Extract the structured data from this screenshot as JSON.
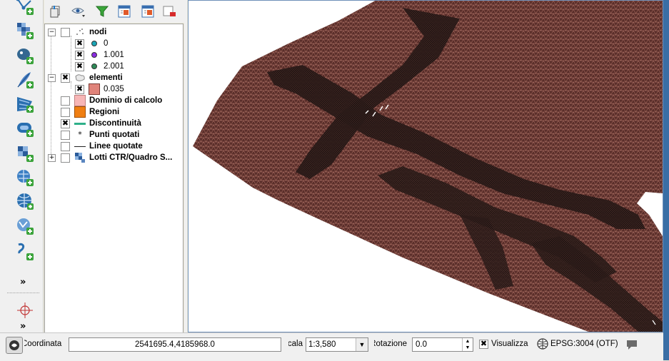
{
  "left_toolbar": {
    "tools": [
      {
        "name": "add-vector-layer-icon"
      },
      {
        "name": "add-raster-layer-icon"
      },
      {
        "name": "add-postgis-layer-icon"
      },
      {
        "name": "add-spatialite-layer-icon"
      },
      {
        "name": "add-mssql-layer-icon"
      },
      {
        "name": "add-oracle-layer-icon"
      },
      {
        "name": "add-wms-layer-icon"
      },
      {
        "name": "add-wcs-layer-icon"
      },
      {
        "name": "add-wfs-layer-icon"
      },
      {
        "name": "add-new-layer-icon"
      },
      {
        "name": "add-delimited-text-layer-icon"
      }
    ],
    "more_label": "»",
    "more2_label": "»"
  },
  "layers_toolbar": {
    "buttons": [
      "add-group-icon",
      "manage-visibility-icon",
      "filter-legend-icon",
      "expand-all-icon",
      "collapse-all-icon",
      "remove-layer-icon"
    ]
  },
  "layers": {
    "nodi": "nodi",
    "nodi_0": "0",
    "nodi_1": "1.001",
    "nodi_2": "2.001",
    "elementi": "elementi",
    "elementi_0": "0.035",
    "dominio": "Dominio di calcolo",
    "regioni": "Regioni",
    "discontinuita": "Discontinuità",
    "punti": "Punti quotati",
    "linee": "Linee quotate",
    "lotti": "Lotti CTR/Quadro S..."
  },
  "colors": {
    "mesh_fill": "#5a2e2a",
    "mesh_line": "#e8a08e",
    "mesh_dense": "#1e1412",
    "nodi_0": "#1aa6b7",
    "nodi_1": "#8a2be2",
    "nodi_2": "#2e8b57",
    "elementi_sym": "#e0837a",
    "dominio_sym": "#f7b6b6",
    "regioni_sym": "#f07f12",
    "discontinuita_sym": "#2fb08a"
  },
  "status": {
    "coord_label": "Coordinata",
    "coord_value": "2541695.4,4185968.0",
    "scale_label": "Scala",
    "scale_value": "1:3,580",
    "rotation_label": "Rotazione",
    "rotation_value": "0.0",
    "render_label": "Visualizza",
    "crs_label": "EPSG:3004 (OTF)"
  }
}
